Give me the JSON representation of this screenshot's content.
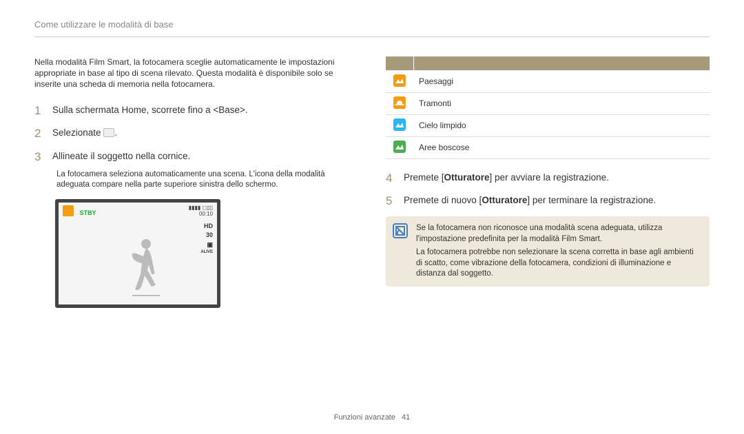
{
  "header": {
    "title": "Come utilizzare le modalità di base"
  },
  "left": {
    "intro": "Nella modalità Film Smart, la fotocamera sceglie automaticamente le impostazioni appropriate in base al tipo di scena rilevato. Questa modalità è disponibile solo se inserite una scheda di memoria nella fotocamera.",
    "step1": {
      "num": "1",
      "text": "Sulla schermata Home, scorrete fino a <Base>."
    },
    "step2": {
      "num": "2",
      "text_a": "Selezionate ",
      "text_b": "."
    },
    "step3": {
      "num": "3",
      "text": "Allineate il soggetto nella cornice.",
      "sub": "La fotocamera seleziona automaticamente una scena. L'icona della modalità adeguata compare nella parte superiore sinistra dello schermo."
    },
    "cam": {
      "stby": "STBY",
      "tr1": "▮▮▮▮ ◻▯▯",
      "tr2": "00:10",
      "hd": "HD",
      "fps": "30",
      "stab": "▣",
      "alive": "ALIVE"
    }
  },
  "right": {
    "scenes": [
      {
        "icon": "mountain-orange",
        "label": "Paesaggi"
      },
      {
        "icon": "sunset-orange",
        "label": "Tramonti"
      },
      {
        "icon": "sky-blue",
        "label": "Cielo limpido"
      },
      {
        "icon": "forest-green",
        "label": "Aree boscose"
      }
    ],
    "step4": {
      "num": "4",
      "text_a": "Premete [",
      "shutter": "Otturatore",
      "text_b": "] per avviare la registrazione."
    },
    "step5": {
      "num": "5",
      "text_a": "Premete di nuovo [",
      "shutter": "Otturatore",
      "text_b": "] per terminare la registrazione."
    },
    "note": {
      "line1": "Se la fotocamera non riconosce una modalità scena adeguata, utilizza l'impostazione predefinita per la modalità Film Smart.",
      "line2": "La fotocamera potrebbe non selezionare la scena corretta in base agli ambienti di scatto, come vibrazione della fotocamera, condizioni di illuminazione e distanza dal soggetto."
    }
  },
  "footer": {
    "section": "Funzioni avanzate",
    "page": "41"
  }
}
